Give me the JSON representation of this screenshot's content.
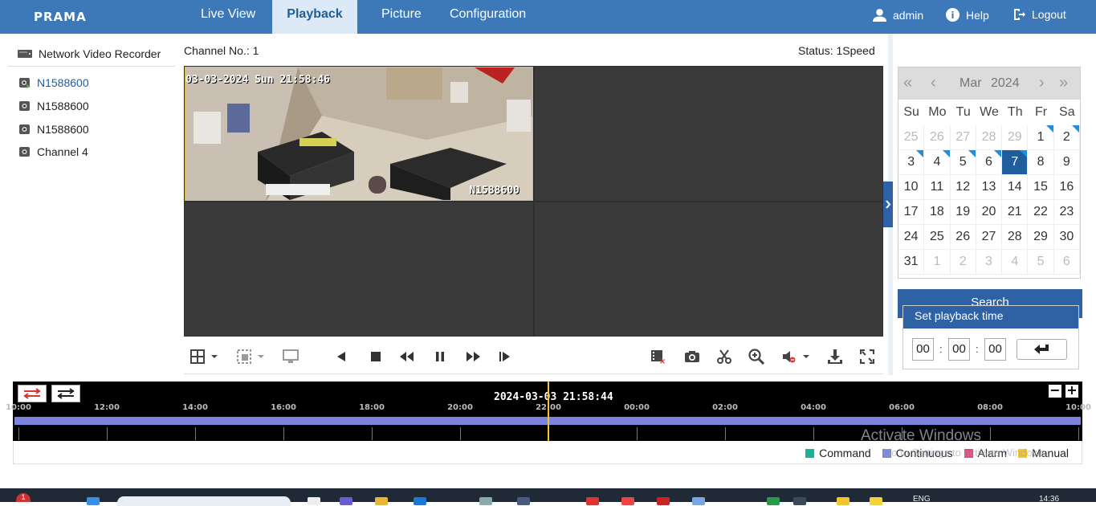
{
  "header": {
    "logo": "PRAMA",
    "tabs": [
      {
        "label": "Live View"
      },
      {
        "label": "Playback"
      },
      {
        "label": "Picture"
      },
      {
        "label": "Configuration"
      }
    ],
    "user": "admin",
    "help": "Help",
    "logout": "Logout"
  },
  "sidebar": {
    "root": "Network Video Recorder",
    "items": [
      {
        "label": "N1588600"
      },
      {
        "label": "N1588600"
      },
      {
        "label": "N1588600"
      },
      {
        "label": "Channel 4"
      }
    ]
  },
  "player": {
    "channel_no": "Channel No.: 1",
    "status": "Status: 1Speed",
    "osd_time": "03-03-2024 Sun 21:58:46",
    "osd_name": "N1588600"
  },
  "calendar": {
    "month": "Mar",
    "year": "2024",
    "weekdays": [
      "Su",
      "Mo",
      "Tu",
      "We",
      "Th",
      "Fr",
      "Sa"
    ],
    "days": [
      {
        "d": "25",
        "m": true
      },
      {
        "d": "26",
        "m": true
      },
      {
        "d": "27",
        "m": true
      },
      {
        "d": "28",
        "m": true
      },
      {
        "d": "29",
        "m": true
      },
      {
        "d": "1",
        "r": true
      },
      {
        "d": "2",
        "r": true
      },
      {
        "d": "3",
        "r": true
      },
      {
        "d": "4",
        "r": true
      },
      {
        "d": "5",
        "r": true
      },
      {
        "d": "6",
        "r": true
      },
      {
        "d": "7",
        "r": true,
        "s": true
      },
      {
        "d": "8"
      },
      {
        "d": "9"
      },
      {
        "d": "10"
      },
      {
        "d": "11"
      },
      {
        "d": "12"
      },
      {
        "d": "13"
      },
      {
        "d": "14"
      },
      {
        "d": "15"
      },
      {
        "d": "16"
      },
      {
        "d": "17"
      },
      {
        "d": "18"
      },
      {
        "d": "19"
      },
      {
        "d": "20"
      },
      {
        "d": "21"
      },
      {
        "d": "22"
      },
      {
        "d": "23"
      },
      {
        "d": "24"
      },
      {
        "d": "25"
      },
      {
        "d": "26"
      },
      {
        "d": "27"
      },
      {
        "d": "28"
      },
      {
        "d": "29"
      },
      {
        "d": "30"
      },
      {
        "d": "31"
      },
      {
        "d": "1",
        "m": true
      },
      {
        "d": "2",
        "m": true
      },
      {
        "d": "3",
        "m": true
      },
      {
        "d": "4",
        "m": true
      },
      {
        "d": "5",
        "m": true
      },
      {
        "d": "6",
        "m": true
      }
    ]
  },
  "search": {
    "label": "Search"
  },
  "playback_time": {
    "title": "Set playback time",
    "hh": "00",
    "mm": "00",
    "ss": "00"
  },
  "timeline": {
    "current": "2024-03-03 21:58:44",
    "ticks": [
      "10:00",
      "12:00",
      "14:00",
      "16:00",
      "18:00",
      "20:00",
      "22:00",
      "00:00",
      "02:00",
      "04:00",
      "06:00",
      "08:00",
      "10:00"
    ]
  },
  "legend": [
    {
      "label": "Command",
      "color": "#1ab394"
    },
    {
      "label": "Continuous",
      "color": "#7b85e0"
    },
    {
      "label": "Alarm",
      "color": "#e8457a"
    },
    {
      "label": "Manual",
      "color": "#f2c52a"
    }
  ],
  "watermark": {
    "line1": "Activate Windows",
    "line2": "Go to Settings to activate Windows."
  },
  "taskbar": {
    "lang": "ENG",
    "time": "14:36",
    "badge": "1"
  }
}
